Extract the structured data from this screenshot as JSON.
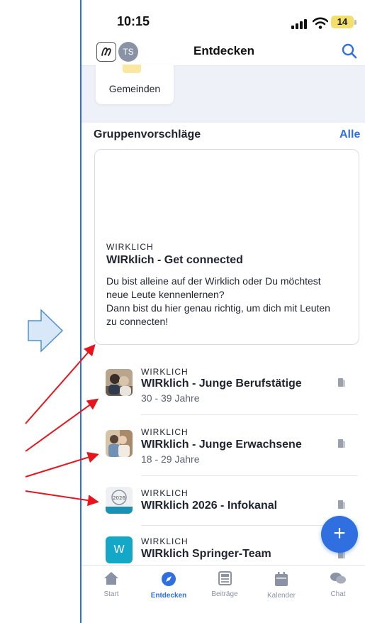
{
  "statusbar": {
    "time": "10:15",
    "battery": "14"
  },
  "header": {
    "title": "Entdecken",
    "avatar_initials": "TS"
  },
  "top_card": {
    "label": "Gemeinden"
  },
  "section": {
    "title": "Gruppenvorschläge",
    "all_link": "Alle"
  },
  "featured": {
    "org": "WIRKLICH",
    "title": "WIRklich - Get connected",
    "description_lines": [
      "Du bist alleine auf der Wirklich oder Du möchtest",
      "neue Leute kennenlernen?",
      "Dann bist du hier genau richtig, um dich mit Leuten",
      "zu connecten!"
    ]
  },
  "groups": [
    {
      "org": "WIRKLICH",
      "name": "WIRklich - Junge Berufstätige",
      "sub": "30 - 39 Jahre",
      "thumb": "photo"
    },
    {
      "org": "WIRKLICH",
      "name": "WIRklich - Junge Erwachsene",
      "sub": "18 - 29 Jahre",
      "thumb": "photo"
    },
    {
      "org": "WIRKLICH",
      "name": "WIRklich 2026 - Infokanal",
      "sub": "",
      "thumb": "logo"
    },
    {
      "org": "WIRKLICH",
      "name": "WIRklich Springer-Team",
      "sub": "",
      "thumb": "letter",
      "letter": "W"
    }
  ],
  "fab": {
    "label": "+"
  },
  "tabs": [
    {
      "label": "Start",
      "icon": "home-icon",
      "active": false
    },
    {
      "label": "Entdecken",
      "icon": "compass-icon",
      "active": true
    },
    {
      "label": "Beiträge",
      "icon": "newspaper-icon",
      "active": false
    },
    {
      "label": "Kalender",
      "icon": "calendar-icon",
      "active": false
    },
    {
      "label": "Chat",
      "icon": "chat-icon",
      "active": false
    }
  ],
  "colors": {
    "accent": "#2f6fe0",
    "annotation_arrow": "#e8141b",
    "annotation_block_arrow": "#4b8fd6",
    "section_bg": "#eef1f8",
    "teal_tile": "#14a7c8"
  }
}
